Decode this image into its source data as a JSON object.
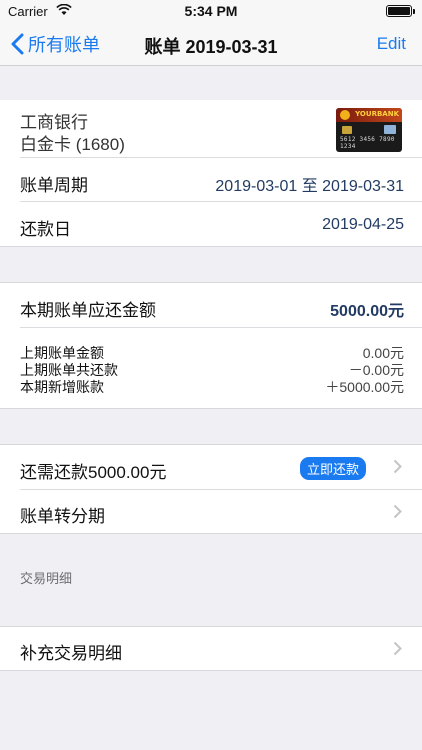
{
  "status_bar": {
    "carrier": "Carrier",
    "time": "5:34 PM"
  },
  "nav": {
    "back_label": "所有账单",
    "title": "账单 2019-03-31",
    "edit_label": "Edit"
  },
  "card": {
    "bank_name": "工商银行",
    "card_name": "白金卡 (1680)",
    "card_brand": "YOURBANK",
    "card_number": "5612 3456 7890 1234"
  },
  "period": {
    "label": "账单周期",
    "value": "2019-03-01 至 2019-03-31"
  },
  "due_date": {
    "label": "还款日",
    "value": "2019-04-25"
  },
  "amount_due": {
    "label": "本期账单应还金额",
    "value": "5000.00元",
    "details": [
      {
        "label": "上期账单金额",
        "value": "0.00元"
      },
      {
        "label": "上期账单共还款",
        "value": "－0.00元"
      },
      {
        "label": "本期新增账款",
        "value": "＋5000.00元"
      }
    ]
  },
  "repay": {
    "label": "还需还款5000.00元",
    "button_label": "立即还款"
  },
  "installment": {
    "label": "账单转分期"
  },
  "transactions_header": "交易明细",
  "add_transactions": {
    "label": "补充交易明细"
  },
  "colors": {
    "accent": "#1a7bf0",
    "value_text": "#223b63",
    "background": "#efeff4"
  }
}
